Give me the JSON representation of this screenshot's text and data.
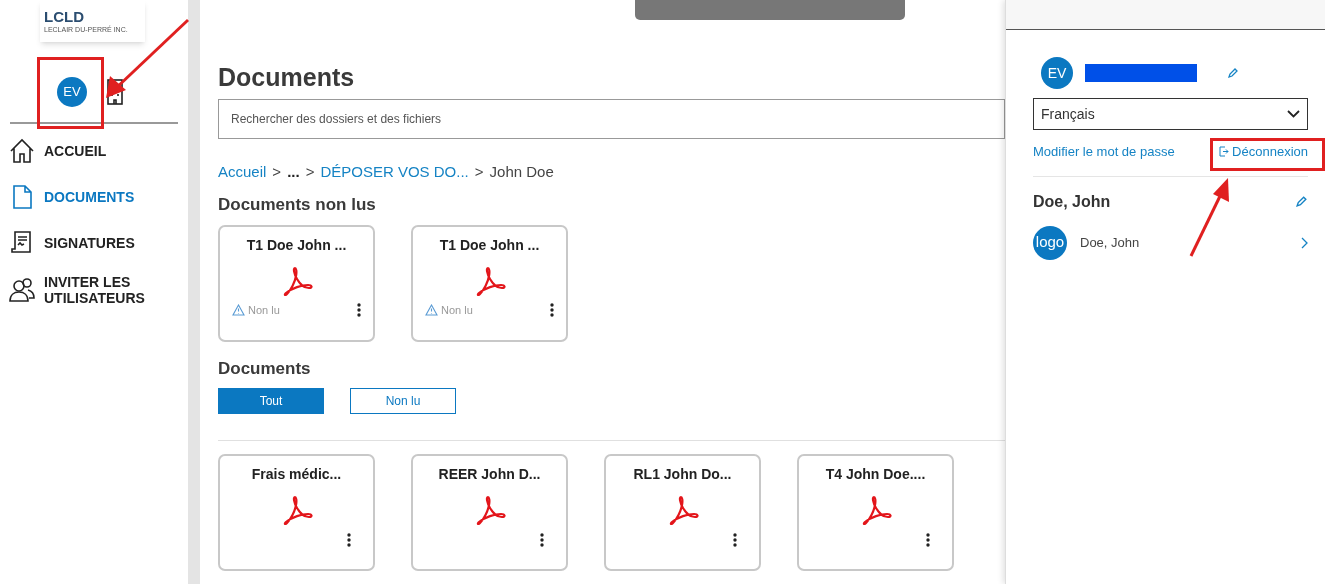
{
  "sidebar": {
    "logo": {
      "mark": "LCLD",
      "company": "LECLAIR DU-PERRÉ INC."
    },
    "avatar": "EV",
    "nav": [
      {
        "label": "ACCUEIL",
        "selected": false
      },
      {
        "label": "DOCUMENTS",
        "selected": true
      },
      {
        "label": "SIGNATURES",
        "selected": false
      },
      {
        "label": "INVITER LES UTILISATEURS",
        "selected": false
      }
    ]
  },
  "main": {
    "title": "Documents",
    "search": {
      "placeholder": "Rechercher des dossiers et des fichiers"
    },
    "breadcrumb": [
      {
        "label": "Accueil",
        "kind": "link"
      },
      {
        "label": ">",
        "kind": "separator"
      },
      {
        "label": "...",
        "kind": "plain"
      },
      {
        "label": ">",
        "kind": "separator"
      },
      {
        "label": "DÉPOSER VOS DO...",
        "kind": "link"
      },
      {
        "label": ">",
        "kind": "separator"
      },
      {
        "label": "John Doe",
        "kind": "current"
      }
    ],
    "unread": {
      "title": "Documents non lus",
      "cards": [
        {
          "title": "T1 Doe John ...",
          "status": "Non lu"
        },
        {
          "title": "T1 Doe John ...",
          "status": "Non lu"
        }
      ]
    },
    "documents": {
      "title": "Documents",
      "filters": [
        {
          "label": "Tout",
          "selected": true
        },
        {
          "label": "Non lu",
          "selected": false
        }
      ],
      "cards": [
        {
          "title": "Frais médic..."
        },
        {
          "title": "REER John D..."
        },
        {
          "title": "RL1 John Do..."
        },
        {
          "title": "T4 John Doe...."
        }
      ]
    }
  },
  "profile_panel": {
    "avatar": "EV",
    "language": "Français",
    "links": [
      {
        "label": "Modifier le mot de passe",
        "kind": "password"
      },
      {
        "label": "Déconnexion",
        "kind": "logout"
      }
    ],
    "account": {
      "name": "Doe, John",
      "items": [
        {
          "logo": "logo",
          "name": "Doe, John"
        }
      ]
    }
  }
}
